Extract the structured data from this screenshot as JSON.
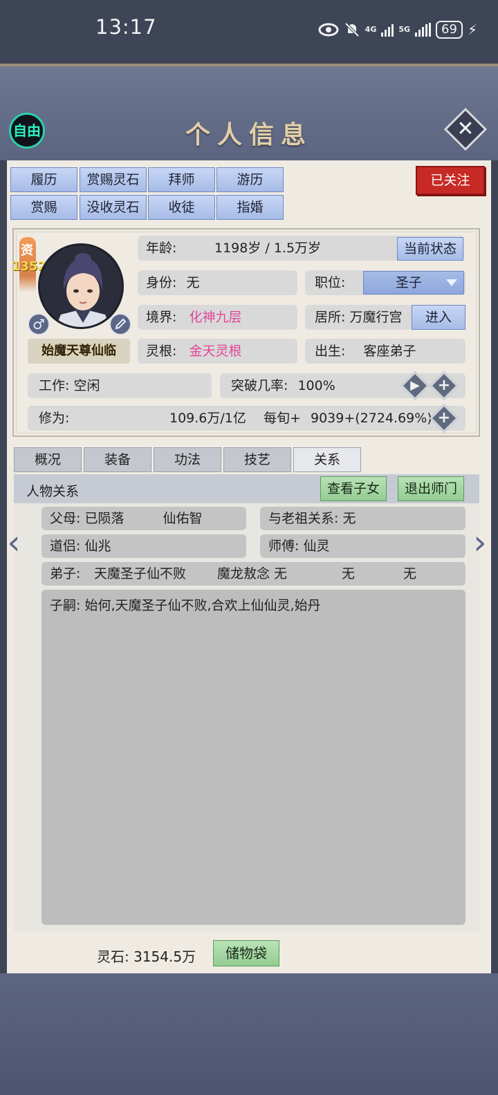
{
  "status_bar": {
    "time": "13:17",
    "network1": "4G",
    "network2": "5G",
    "battery": "69"
  },
  "header": {
    "title": "个人信息",
    "free_label": "自由"
  },
  "top_buttons": [
    "履历",
    "赏赐灵石",
    "拜师",
    "游历",
    "赏赐",
    "没收灵石",
    "收徒",
    "指婚"
  ],
  "follow_label": "已关注",
  "character": {
    "aptitude_label": "资",
    "aptitude_value": "1352",
    "name": "始魔天尊仙临",
    "gender_symbol": "♂",
    "age_label": "年龄:",
    "age_value": "1198岁 / 1.5万岁",
    "state_button": "当前状态",
    "identity_label": "身份:",
    "identity_value": "无",
    "position_label": "职位:",
    "position_value": "圣子",
    "realm_label": "境界:",
    "realm_value": "化神九层",
    "residence_label": "居所:",
    "residence_value": "万魔行宫",
    "enter_button": "进入",
    "root_label": "灵根:",
    "root_value": "金天灵根",
    "birth_label": "出生:",
    "birth_value": "客座弟子",
    "work_label": "工作:",
    "work_value": "空闲",
    "breakthrough_label": "突破几率:",
    "breakthrough_value": "100%",
    "cultivation_label": "修为:",
    "cultivation_value": "109.6万/1亿",
    "per_turn_label": "每旬+",
    "per_turn_value": "9039+(2724.69%)"
  },
  "tabs": [
    "概况",
    "装备",
    "功法",
    "技艺",
    "关系"
  ],
  "relations": {
    "header": "人物关系",
    "view_children_button": "查看子女",
    "leave_sect_button": "退出师门",
    "parents_label": "父母:",
    "parents_value": "已陨落",
    "parents_extra": "仙佑智",
    "ancestor_label": "与老祖关系:",
    "ancestor_value": "无",
    "partner_label": "道侣:",
    "partner_value": "仙兆",
    "master_label": "师傅:",
    "master_value": "仙灵",
    "disciples_label": "弟子:",
    "disciples": [
      "天魔圣子仙不败",
      "魔龙敖念 无",
      "无",
      "无"
    ],
    "descendants_label": "子嗣:",
    "descendants_value": "始何,天魔圣子仙不败,合欢上仙仙灵,始丹"
  },
  "footer": {
    "stones_label": "灵石:",
    "stones_value": "3154.5万",
    "bag_button": "储物袋"
  },
  "colors": {
    "accent_blue": "#a6bbe6",
    "pink_value": "#e0479a",
    "follow_red": "#c72a25",
    "green_button": "#93cc92"
  }
}
